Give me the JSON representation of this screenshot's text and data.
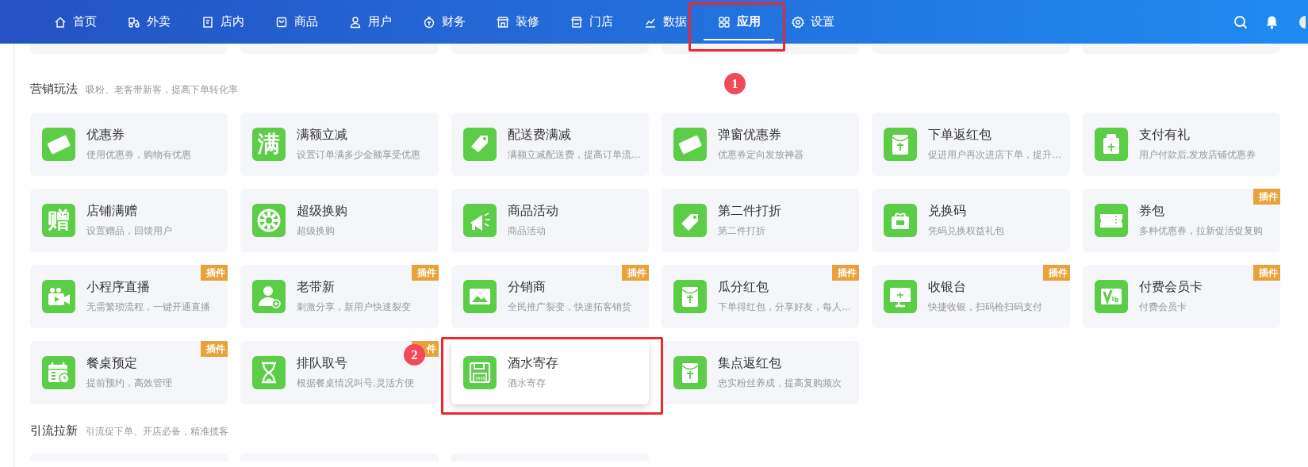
{
  "nav": {
    "items": [
      {
        "label": "首页",
        "selected": false
      },
      {
        "label": "外卖",
        "selected": false
      },
      {
        "label": "店内",
        "selected": false
      },
      {
        "label": "商品",
        "selected": false
      },
      {
        "label": "用户",
        "selected": false
      },
      {
        "label": "财务",
        "selected": false
      },
      {
        "label": "装修",
        "selected": false
      },
      {
        "label": "门店",
        "selected": false
      },
      {
        "label": "数据",
        "selected": false
      },
      {
        "label": "应用",
        "selected": true
      },
      {
        "label": "设置",
        "selected": false
      }
    ]
  },
  "sections": [
    {
      "title": "营销玩法",
      "subtitle": "吸粉、老客带新客，提高下单转化率",
      "cards": [
        {
          "title": "优惠券",
          "desc": "使用优惠券，购物有优惠",
          "hovered": false
        },
        {
          "title": "满额立减",
          "desc": "设置订单满多少金额享受优惠",
          "icon_text": "满",
          "hovered": false
        },
        {
          "title": "配送费满减",
          "desc": "满额立减配送费，提高订单流…",
          "hovered": false
        },
        {
          "title": "弹窗优惠券",
          "desc": "优惠券定向发放神器",
          "hovered": false
        },
        {
          "title": "下单返红包",
          "desc": "促进用户再次进店下单，提升…",
          "hovered": false
        },
        {
          "title": "支付有礼",
          "desc": "用户付款后,发放店铺优惠券",
          "hovered": false
        },
        {
          "title": "店铺满赠",
          "desc": "设置赠品，回馈用户",
          "icon_text": "赠",
          "hovered": false
        },
        {
          "title": "超级换购",
          "desc": "超级换购",
          "hovered": false
        },
        {
          "title": "商品活动",
          "desc": "商品活动",
          "hovered": false
        },
        {
          "title": "第二件打折",
          "desc": "第二件打折",
          "hovered": false
        },
        {
          "title": "兑换码",
          "desc": "凭码兑换权益礼包",
          "hovered": false
        },
        {
          "title": "券包",
          "desc": "多种优惠券，拉新促活促复购",
          "badge": "插件",
          "hovered": false
        },
        {
          "title": "小程序直播",
          "desc": "无需繁琐流程，一键开通直播",
          "badge": "插件",
          "hovered": false
        },
        {
          "title": "老带新",
          "desc": "刺激分享，新用户快速裂变",
          "badge": "插件",
          "hovered": false
        },
        {
          "title": "分销商",
          "desc": "全民推广裂变，快速拓客销货",
          "badge": "插件",
          "hovered": false
        },
        {
          "title": "瓜分红包",
          "desc": "下单得红包，分享好友，每人…",
          "badge": "插件",
          "hovered": false
        },
        {
          "title": "收银台",
          "desc": "快捷收银，扫码枪扫码支付",
          "badge": "插件",
          "hovered": false
        },
        {
          "title": "付费会员卡",
          "desc": "付费会员卡",
          "badge": "插件",
          "hovered": false
        },
        {
          "title": "餐桌预定",
          "desc": "提前预约，高效管理",
          "badge": "插件",
          "hovered": false
        },
        {
          "title": "排队取号",
          "desc": "根据餐桌情况叫号,灵活方便",
          "badge": "件",
          "hovered": false
        },
        {
          "title": "酒水寄存",
          "desc": "酒水寄存",
          "hovered": true
        },
        {
          "title": "集点返红包",
          "desc": "忠实粉丝养成，提高复购频次",
          "hovered": false
        }
      ]
    },
    {
      "title": "引流拉新",
      "subtitle": "引流促下单、开店必备，精准揽客"
    }
  ],
  "annotations": [
    {
      "number": "1"
    },
    {
      "number": "2"
    }
  ]
}
